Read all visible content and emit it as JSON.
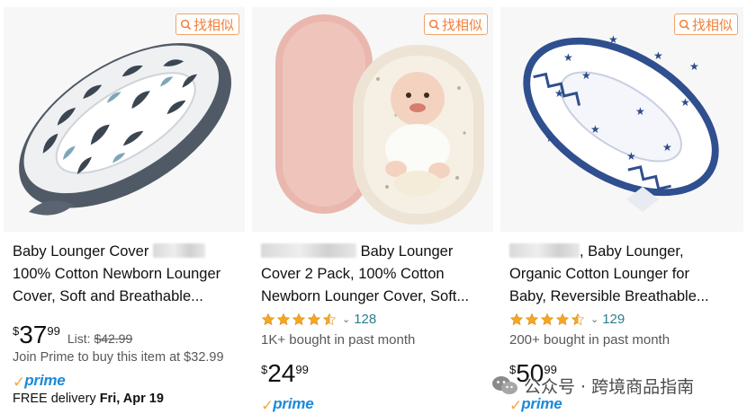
{
  "find_similar_label": "找相似",
  "watermark": {
    "text": "公众号 · 跨境商品指南"
  },
  "colors": {
    "accent_orange": "#f0813d",
    "star": "#f5a623",
    "link_teal": "#2a7d8f",
    "prime_blue": "#1c8ad8"
  },
  "products": [
    {
      "title_line1": "Baby Lounger Cover",
      "title_line2": "100% Cotton Newborn Lounger",
      "title_line3": "Cover, Soft and Breathable...",
      "price": {
        "symbol": "$",
        "whole": "37",
        "fraction": "99"
      },
      "list_label": "List:",
      "list_price": "$42.99",
      "prime_offer": "Join Prime to buy this item at $32.99",
      "prime_label": "prime",
      "delivery_label": "FREE delivery",
      "delivery_date": "Fri, Apr 19",
      "image_icon": "baby-lounger-leaf-print-image"
    },
    {
      "title_line1": "Baby Lounger",
      "title_line2": "Cover 2 Pack, 100% Cotton",
      "title_line3": "Newborn Lounger Cover, Soft...",
      "rating": 4.5,
      "rating_count": "128",
      "bought": "1K+ bought in past month",
      "price": {
        "symbol": "$",
        "whole": "24",
        "fraction": "99"
      },
      "prime_label": "prime",
      "image_icon": "baby-lounger-two-pack-image"
    },
    {
      "title_line1": ", Baby Lounger,",
      "title_line2": "Organic Cotton Lounger for",
      "title_line3": "Baby, Reversible Breathable...",
      "rating": 4.5,
      "rating_count": "129",
      "bought": "200+ bought in past month",
      "price": {
        "symbol": "$",
        "whole": "50",
        "fraction": "99"
      },
      "prime_label": "prime",
      "image_icon": "baby-lounger-star-print-image"
    }
  ]
}
